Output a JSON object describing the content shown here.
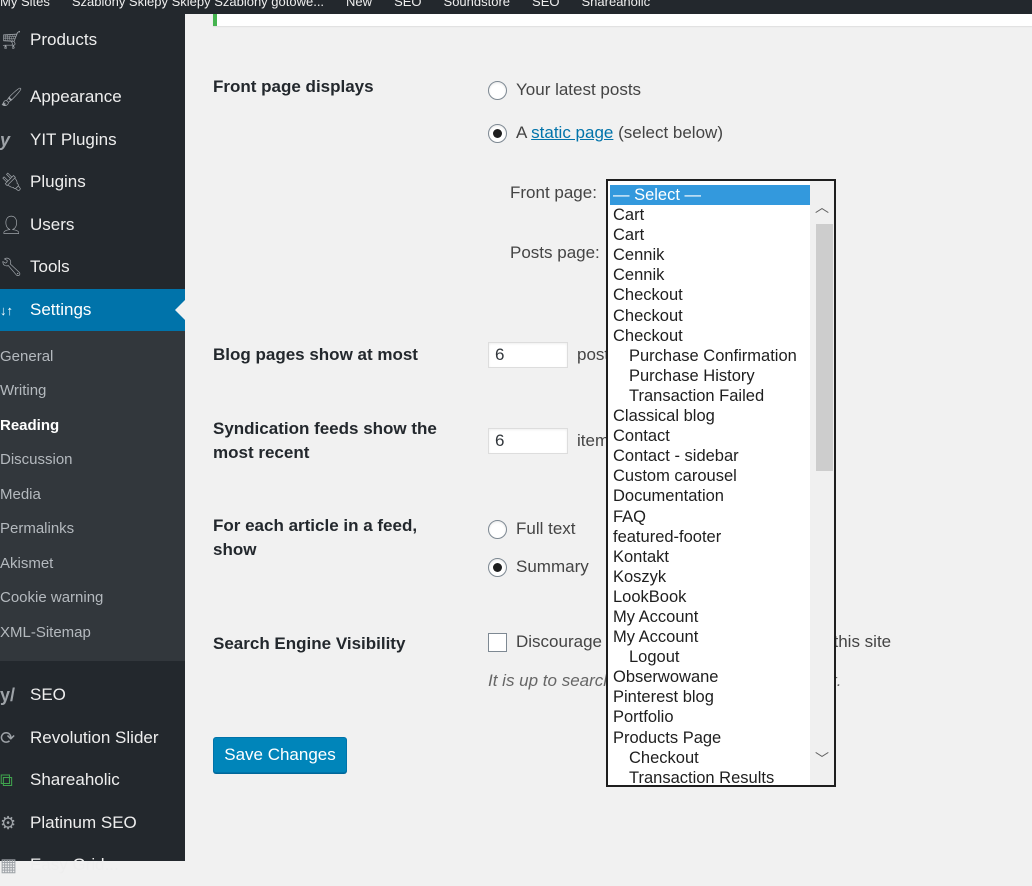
{
  "adminbar": {
    "items": [
      "My Sites",
      "Szablony Sklepy Sklepy Szablony gotowe...",
      "New",
      "SEO",
      "Soundstore",
      "SEO",
      "Shareaholic"
    ]
  },
  "sidebar": {
    "items": [
      {
        "label": "Products",
        "icon": "cart-icon"
      },
      {
        "label": "Appearance",
        "icon": "paintbrush-icon"
      },
      {
        "label": "YIT Plugins",
        "icon": "yit-icon"
      },
      {
        "label": "Plugins",
        "icon": "plug-icon"
      },
      {
        "label": "Users",
        "icon": "user-icon"
      },
      {
        "label": "Tools",
        "icon": "wrench-icon"
      },
      {
        "label": "Settings",
        "icon": "settings-icon"
      }
    ],
    "submenu": [
      "General",
      "Writing",
      "Reading",
      "Discussion",
      "Media",
      "Permalinks",
      "Akismet",
      "Cookie warning",
      "XML-Sitemap"
    ],
    "current_sub": "Reading",
    "bottom_items": [
      {
        "label": "SEO",
        "icon": "yoast-icon"
      },
      {
        "label": "Revolution Slider",
        "icon": "refresh-icon"
      },
      {
        "label": "Shareaholic",
        "icon": "shareaholic-icon"
      },
      {
        "label": "Platinum SEO",
        "icon": "gear-icon"
      },
      {
        "label": "Easy Grid...",
        "icon": "grid-icon"
      }
    ]
  },
  "form": {
    "front_page_displays": {
      "label": "Front page displays",
      "option_latest": "Your latest posts",
      "option_static_prefix": "A",
      "option_static_link": "static page",
      "option_static_suffix": "(select below)",
      "selected": "static",
      "front_page_label": "Front page:",
      "posts_page_label": "Posts page:"
    },
    "blog_pages": {
      "label": "Blog pages show at most",
      "value": "6",
      "unit": "posts"
    },
    "syndication": {
      "label": "Syndication feeds show the most recent",
      "value": "6",
      "unit": "items"
    },
    "feed_article": {
      "label": "For each article in a feed, show",
      "option_full": "Full text",
      "option_summary": "Summary",
      "selected": "summary"
    },
    "search_visibility": {
      "label": "Search Engine Visibility",
      "checkbox_label": "Discourage search engines from indexing this site",
      "checked": false,
      "description": "It is up to search engines to honor this request."
    },
    "save_label": "Save Changes"
  },
  "dropdown": {
    "selected": "— Select —",
    "options": [
      {
        "label": "— Select —",
        "indent": false
      },
      {
        "label": "Cart",
        "indent": false
      },
      {
        "label": "Cart",
        "indent": false
      },
      {
        "label": "Cennik",
        "indent": false
      },
      {
        "label": "Cennik",
        "indent": false
      },
      {
        "label": "Checkout",
        "indent": false
      },
      {
        "label": "Checkout",
        "indent": false
      },
      {
        "label": "Checkout",
        "indent": false
      },
      {
        "label": "Purchase Confirmation",
        "indent": true
      },
      {
        "label": "Purchase History",
        "indent": true
      },
      {
        "label": "Transaction Failed",
        "indent": true
      },
      {
        "label": "Classical blog",
        "indent": false
      },
      {
        "label": "Contact",
        "indent": false
      },
      {
        "label": "Contact - sidebar",
        "indent": false
      },
      {
        "label": "Custom carousel",
        "indent": false
      },
      {
        "label": "Documentation",
        "indent": false
      },
      {
        "label": "FAQ",
        "indent": false
      },
      {
        "label": "featured-footer",
        "indent": false
      },
      {
        "label": "Kontakt",
        "indent": false
      },
      {
        "label": "Koszyk",
        "indent": false
      },
      {
        "label": "LookBook",
        "indent": false
      },
      {
        "label": "My Account",
        "indent": false
      },
      {
        "label": "My Account",
        "indent": false
      },
      {
        "label": "Logout",
        "indent": true
      },
      {
        "label": "Obserwowane",
        "indent": false
      },
      {
        "label": "Pinterest blog",
        "indent": false
      },
      {
        "label": "Portfolio",
        "indent": false
      },
      {
        "label": "Products Page",
        "indent": false
      },
      {
        "label": "Checkout",
        "indent": true
      },
      {
        "label": "Transaction Results",
        "indent": true
      }
    ]
  },
  "colors": {
    "accent": "#0073aa",
    "sidebar": "#23282d",
    "submenu": "#32373c",
    "notice_border": "#46b450",
    "select_highlight": "#3399dd"
  }
}
